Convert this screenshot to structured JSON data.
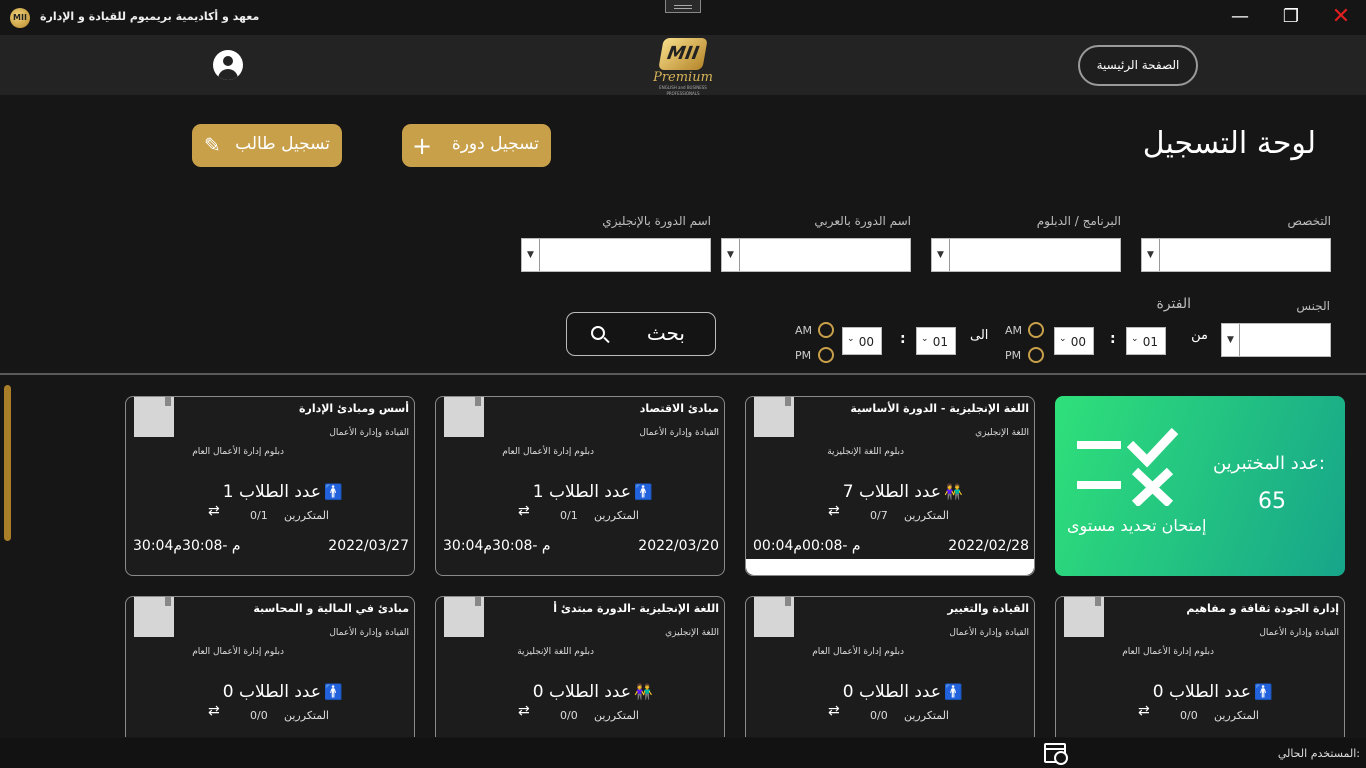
{
  "window": {
    "title": "معهد و أكاديمية بريميوم للقيادة و الإدارة",
    "logo_text": "MII",
    "minimize_icon": "minimize-icon",
    "maximize_icon": "maximize-icon",
    "close_icon": "close-icon",
    "close_color": "#e02020"
  },
  "header": {
    "home_label": "الصفحة الرئيسية",
    "brand_mark": "MII",
    "brand_word": "Premium",
    "brand_tagline": "ENGLISH and BUSINESS PROFESSIONALS",
    "user_icon": "user-circle-icon"
  },
  "page": {
    "title": "لوحة التسجيل",
    "register_student_label": "تسجيل طالب",
    "register_student_icon": "edit-icon",
    "register_course_label": "تسجيل دورة",
    "register_course_icon": "plus-icon",
    "accent": "#c9a04a"
  },
  "filters": {
    "specialty_label": "التخصص",
    "program_label": "البرنامج / الدبلوم",
    "course_ar_label": "اسم الدورة بالعربي",
    "course_en_label": "اسم الدورة بالإنجليزي",
    "gender_label": "الجنس",
    "period_label": "الفترة",
    "from_label": "من",
    "to_label": "الى",
    "from_hour": "01",
    "from_minute": "00",
    "to_hour": "01",
    "to_minute": "00",
    "colon": ":",
    "am": "AM",
    "pm": "PM",
    "search_label": "بحث"
  },
  "stats": {
    "label": "عدد المختبرين:",
    "value": "65",
    "description": "إمتحان تحديد مستوى",
    "icon": "check-cross-icon"
  },
  "courses": [
    {
      "name": "اللغة الإنجليزية - الدورة الأساسية",
      "specialty": "اللغة الإنجليزي",
      "program": "دبلوم اللغة الإنجليزية",
      "students_label": "عدد الطلاب",
      "students": "7",
      "students_icon": "male-female-icon",
      "repeaters_label": "المتكررين",
      "repeaters": "0/7",
      "date": "2022/02/28",
      "time": "00:04م -00:08م"
    },
    {
      "name": "مبادئ الاقتصاد",
      "specialty": "القيادة وإدارة الأعمال",
      "program": "دبلوم إدارة الأعمال العام",
      "students_label": "عدد الطلاب",
      "students": "1",
      "students_icon": "male-icon",
      "repeaters_label": "المتكررين",
      "repeaters": "0/1",
      "date": "2022/03/20",
      "time": "30:04م -30:08م"
    },
    {
      "name": "أسس ومبادئ الإدارة",
      "specialty": "القيادة وإدارة الأعمال",
      "program": "دبلوم إدارة الأعمال العام",
      "students_label": "عدد الطلاب",
      "students": "1",
      "students_icon": "male-icon",
      "repeaters_label": "المتكررين",
      "repeaters": "0/1",
      "date": "2022/03/27",
      "time": "30:04م -30:08م"
    },
    {
      "name": "إدارة الجودة ثقافة و مفاهيم",
      "specialty": "القيادة وإدارة الأعمال",
      "program": "دبلوم إدارة الأعمال العام",
      "students_label": "عدد الطلاب",
      "students": "0",
      "students_icon": "male-icon",
      "repeaters_label": "المتكررين",
      "repeaters": "0/0"
    },
    {
      "name": "القيادة والتغيير",
      "specialty": "القيادة وإدارة الأعمال",
      "program": "دبلوم إدارة الأعمال العام",
      "students_label": "عدد الطلاب",
      "students": "0",
      "students_icon": "male-icon",
      "repeaters_label": "المتكررين",
      "repeaters": "0/0"
    },
    {
      "name": "اللغة الإنجليزية -الدورة مبتدئ أ",
      "specialty": "اللغة الإنجليزي",
      "program": "دبلوم اللغة الإنجليزية",
      "students_label": "عدد الطلاب",
      "students": "0",
      "students_icon": "male-female-icon",
      "repeaters_label": "المتكررين",
      "repeaters": "0/0"
    },
    {
      "name": "مبادئ في المالية و المحاسبة",
      "specialty": "القيادة وإدارة الأعمال",
      "program": "دبلوم إدارة الأعمال العام",
      "students_label": "عدد الطلاب",
      "students": "0",
      "students_icon": "male-icon",
      "repeaters_label": "المتكررين",
      "repeaters": "0/0"
    }
  ],
  "footer": {
    "current_user_label": "المستخدم الحالي:",
    "calendar_icon": "calendar-clock-icon"
  }
}
